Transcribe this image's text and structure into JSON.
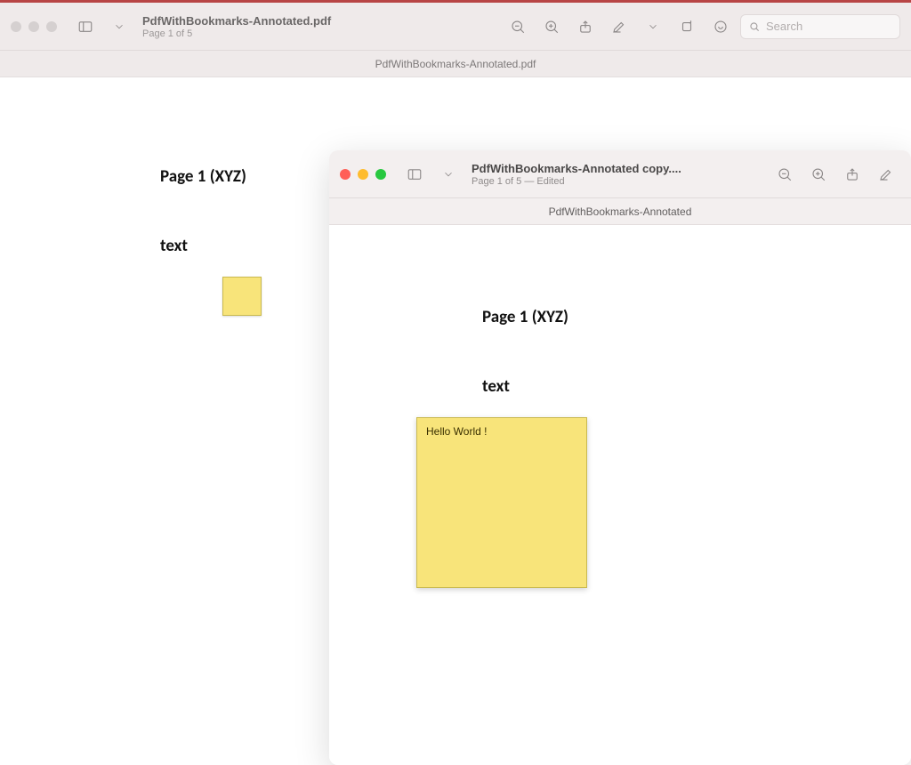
{
  "backWindow": {
    "title": "PdfWithBookmarks-Annotated.pdf",
    "subtitle": "Page 1 of 5",
    "tabLabel": "PdfWithBookmarks-Annotated.pdf",
    "search": {
      "placeholder": "Search"
    },
    "page": {
      "heading": "Page 1 (XYZ)",
      "text": "text"
    }
  },
  "frontWindow": {
    "title": "PdfWithBookmarks-Annotated copy....",
    "subtitle": "Page 1 of 5 — Edited",
    "tabLabel": "PdfWithBookmarks-Annotated",
    "page": {
      "heading": "Page 1 (XYZ)",
      "text": "text",
      "noteText": "Hello World !"
    }
  }
}
